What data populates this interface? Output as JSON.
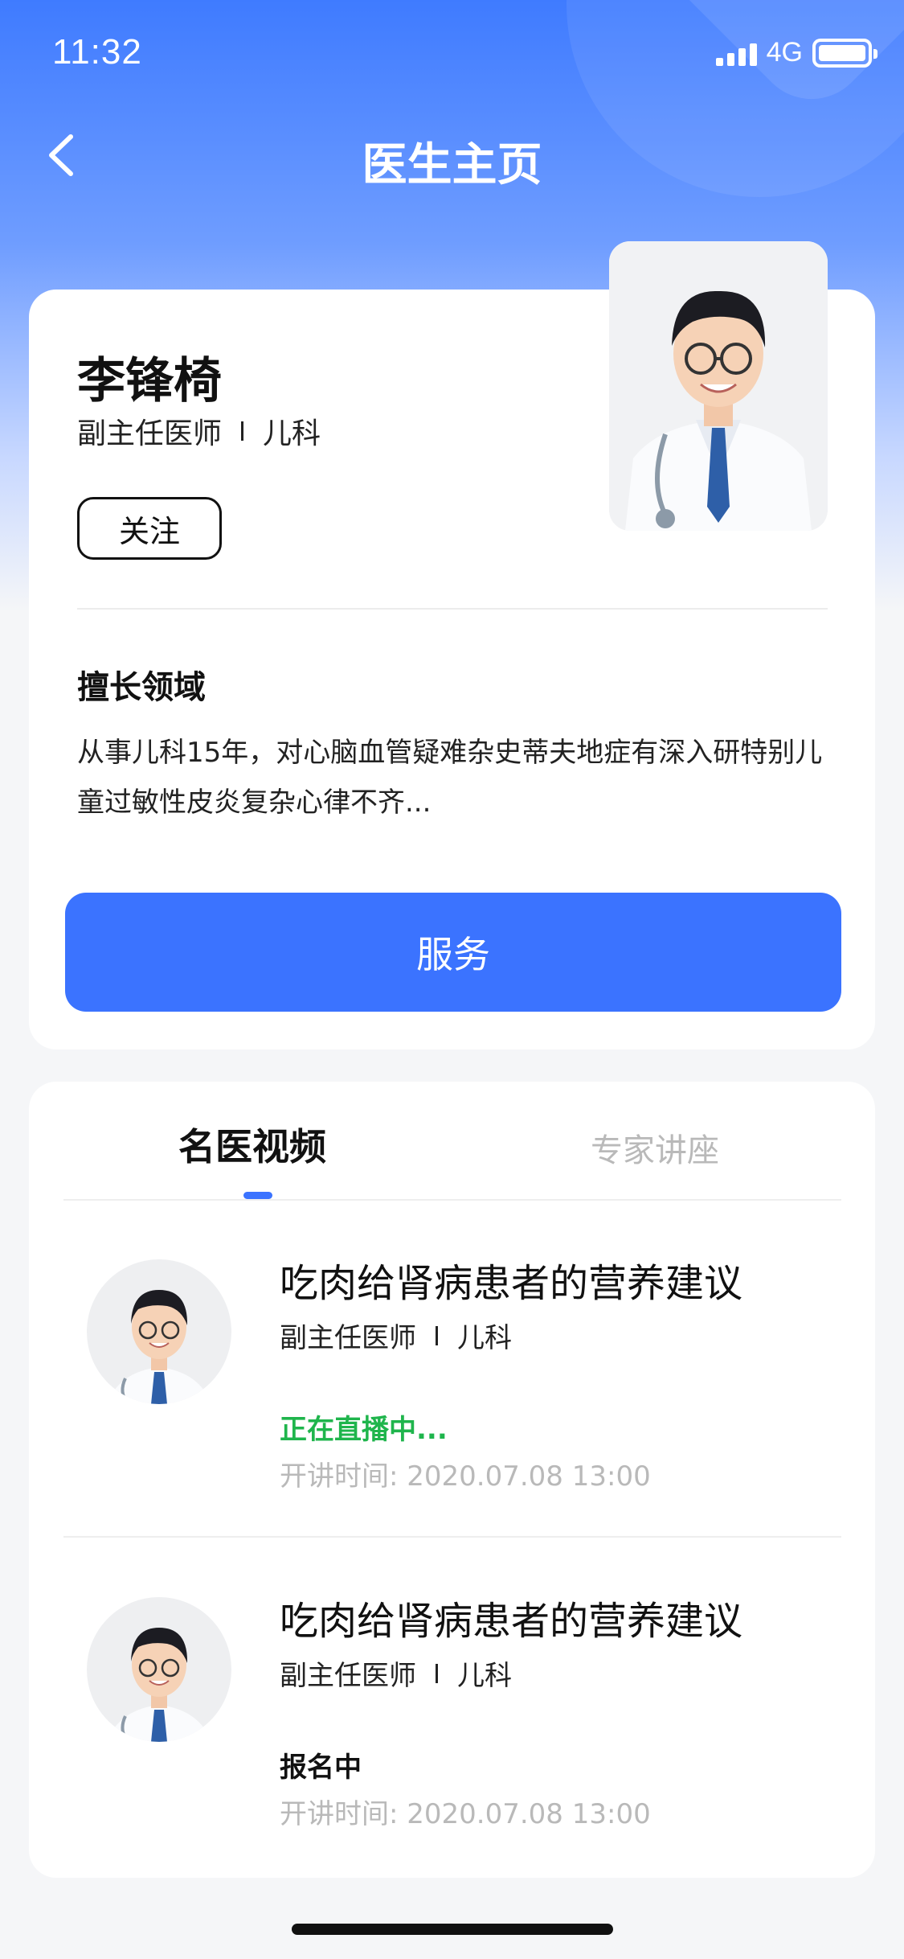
{
  "status_bar": {
    "time": "11:32",
    "network": "4G",
    "battery_level": 1.0,
    "signal_icon": "signal-bars-icon",
    "battery_icon": "battery-icon"
  },
  "nav": {
    "back_icon": "chevron-left-icon",
    "title": "医生主页"
  },
  "colors": {
    "primary": "#3b73ff",
    "live_status": "#1fb54c",
    "muted_text": "#b9b9b9"
  },
  "doctor": {
    "name": "李锋椅",
    "title": "副主任医师",
    "department": "儿科",
    "follow_label": "关注",
    "specialty_heading": "擅长领域",
    "specialty_text": "从事儿科15年，对心脑血管疑难杂史蒂夫地症有深入研特别儿童过敏性皮炎复杂心律不齐...",
    "service_label": "服务"
  },
  "tabs": [
    {
      "label": "名医视频",
      "active": true
    },
    {
      "label": "专家讲座",
      "active": false
    }
  ],
  "videos": [
    {
      "title": "吃肉给肾病患者的营养建议",
      "doctor_title": "副主任医师",
      "department": "儿科",
      "status": "正在直播中...",
      "time": "开讲时间: 2020.07.08 13:00"
    },
    {
      "title": "吃肉给肾病患者的营养建议",
      "doctor_title": "副主任医师",
      "department": "儿科",
      "status": "报名中",
      "time": "开讲时间: 2020.07.08 13:00"
    }
  ]
}
